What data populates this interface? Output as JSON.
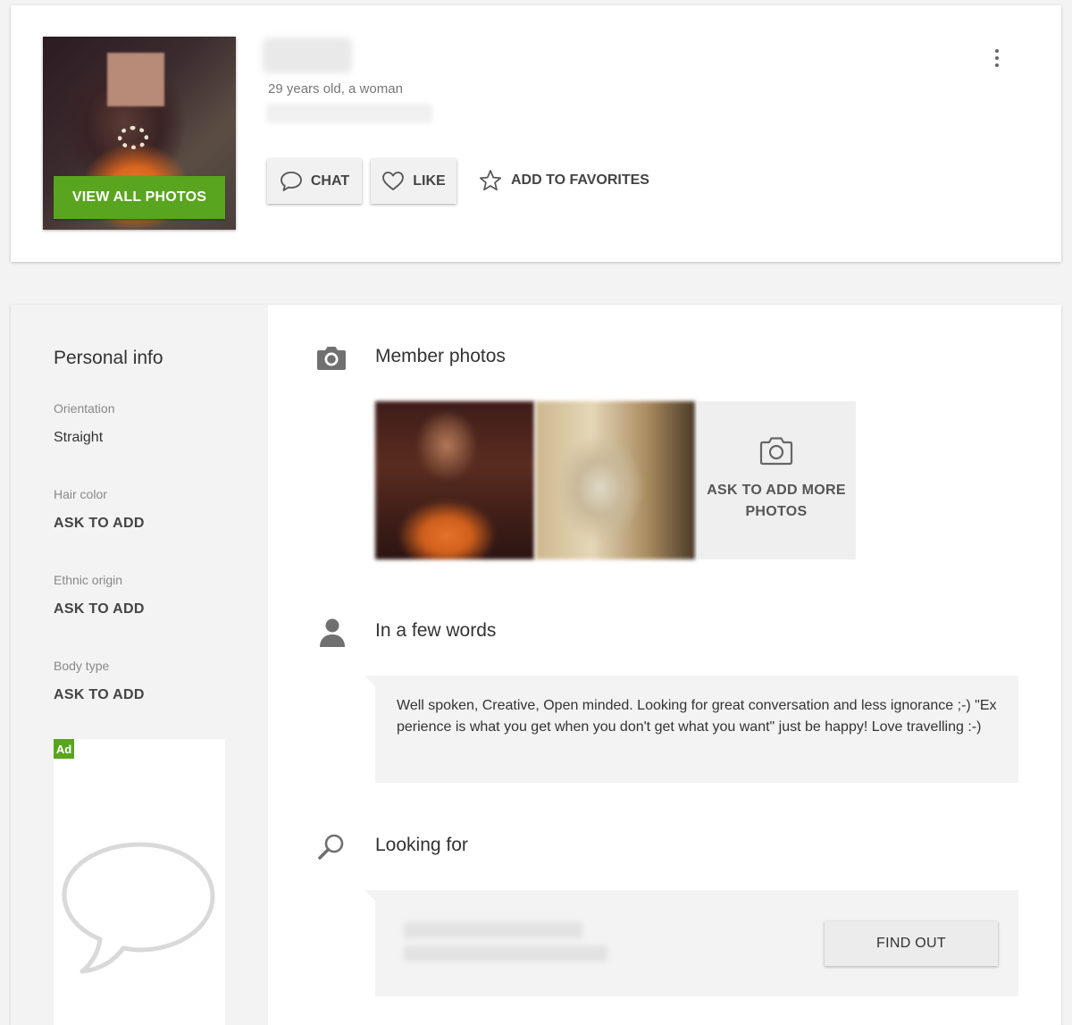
{
  "profile": {
    "age_gender": "29 years old, a woman",
    "view_photos_label": "VIEW ALL PHOTOS"
  },
  "actions": {
    "chat_label": "CHAT",
    "like_label": "LIKE",
    "favorites_label": "ADD TO FAVORITES"
  },
  "sidebar": {
    "title": "Personal info",
    "fields": [
      {
        "label": "Orientation",
        "value": "Straight"
      },
      {
        "label": "Hair color",
        "value": "ASK TO ADD"
      },
      {
        "label": "Ethnic origin",
        "value": "ASK TO ADD"
      },
      {
        "label": "Body type",
        "value": "ASK TO ADD"
      }
    ],
    "ad_badge": "Ad"
  },
  "photos": {
    "title": "Member photos",
    "ask_more_label": "ASK TO ADD MORE PHOTOS"
  },
  "about": {
    "title": "In a few words",
    "text": "Well spoken, Creative, Open minded. Looking for great conversation and less ignorance ;-) \"Experience is what you get when you don't get what you want\" just be happy! Love travelling :-)"
  },
  "looking_for": {
    "title": "Looking for",
    "find_out_label": "FIND OUT"
  },
  "icons": {
    "chat": "speech-bubble-icon",
    "like": "heart-icon",
    "favorites": "star-icon",
    "menu": "kebab-menu-icon",
    "photos": "camera-icon",
    "about": "person-icon",
    "looking_for": "search-icon",
    "ad": "speech-bubble-icon"
  },
  "colors": {
    "accent": "#5aa51f",
    "background": "#f3f3f3"
  }
}
